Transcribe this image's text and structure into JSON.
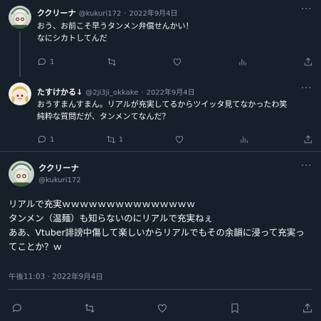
{
  "tweets": [
    {
      "display_name": "ククリーナ",
      "handle": "@kukuri172",
      "dot": "·",
      "date": "2022年9月4日",
      "lines": [
        "おう、お前こそ早うタンメン弁償せんかい！",
        "なにシカトしてんだ"
      ],
      "counts": {
        "reply": "1",
        "retweet": "",
        "like": "",
        "views": ""
      }
    },
    {
      "display_name": "たすけかる↓",
      "handle": "@2ji3ji_okkake",
      "dot": "·",
      "date": "2022年9月4日",
      "lines": [
        "おうすまんすまん。リアルが充実してるからツイッタ見てなかったわ笑",
        "純粋な質問だが、タンメンてなんだ？"
      ],
      "counts": {
        "reply": "1",
        "retweet": "1",
        "like": "",
        "views": ""
      }
    }
  ],
  "main_tweet": {
    "display_name": "ククリーナ",
    "handle": "@kukuri172",
    "lines": [
      "リアルで充実ｗｗｗｗｗｗｗｗｗｗｗｗｗｗｗ",
      "タンメン（温麺）も知らないのにリアルで充実ねぇ",
      "ああ、Vtuber誹謗中傷して楽しいからリアルでもその余韻に浸って充実っ",
      "てことか？ｗ"
    ],
    "timestamp": "午後11:03 · 2022年9月4日"
  },
  "icons": {
    "reply": "speech-bubble-icon",
    "retweet": "retweet-arrows-icon",
    "like": "heart-icon",
    "views": "bar-chart-icon",
    "share": "share-upload-icon",
    "bookmark": "bookmark-icon",
    "more": "more-dots-icon"
  },
  "colors": {
    "background": "#15202b",
    "text": "#f7f9f9",
    "muted": "#8b98a5",
    "border": "#38444d"
  }
}
